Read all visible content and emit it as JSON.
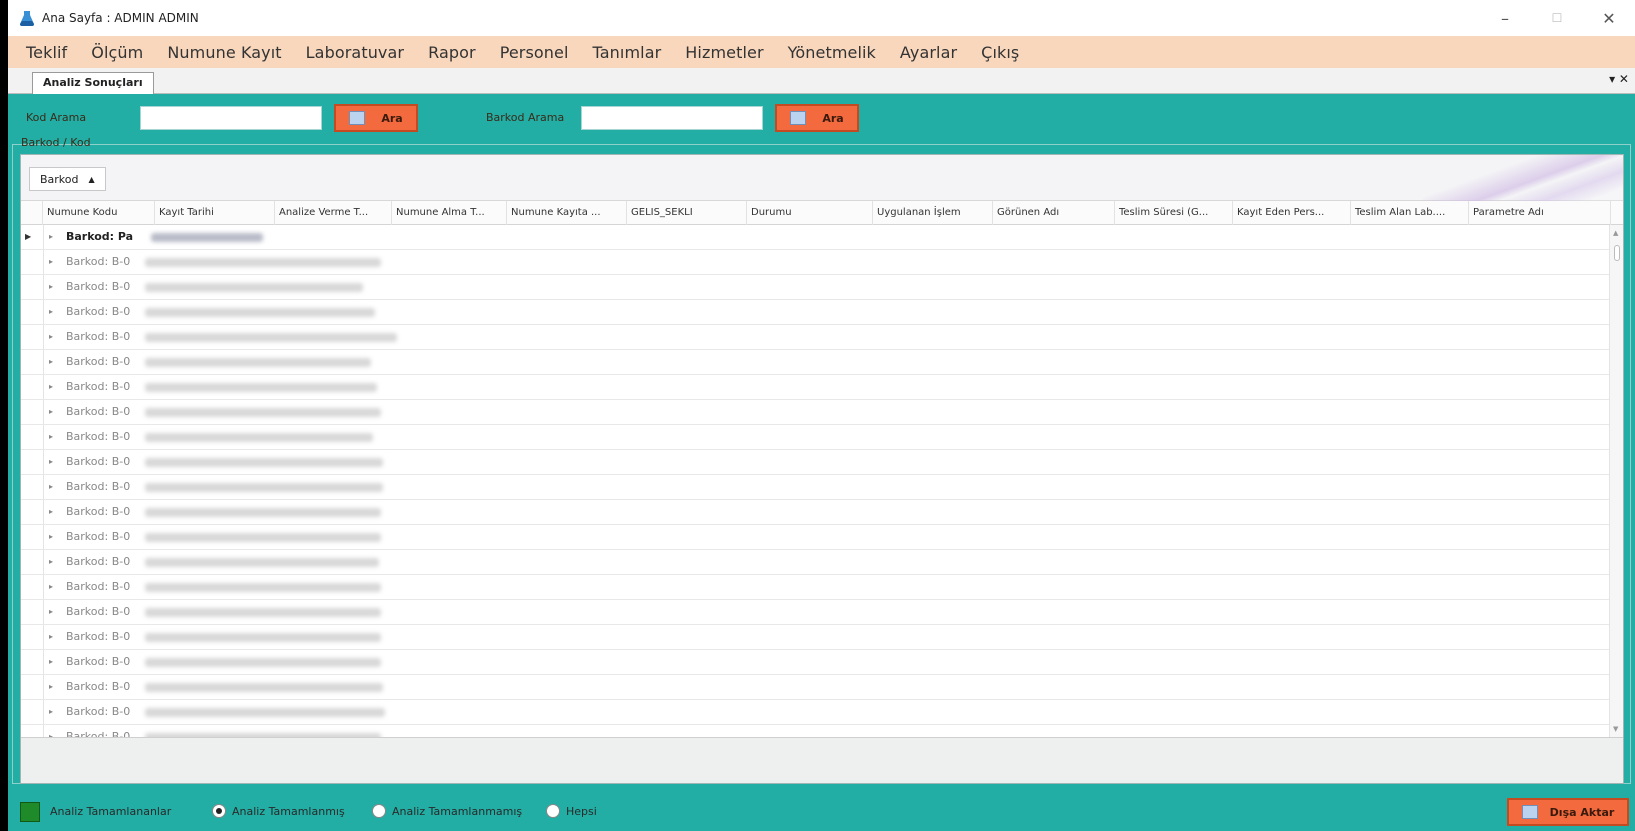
{
  "window": {
    "title": "Ana Sayfa : ADMIN ADMIN",
    "controls": {
      "minimize": "–",
      "maximize": "☐",
      "close": "✕"
    }
  },
  "menu": [
    "Teklif",
    "Ölçüm",
    "Numune Kayıt",
    "Laboratuvar",
    "Rapor",
    "Personel",
    "Tanımlar",
    "Hizmetler",
    "Yönetmelik",
    "Ayarlar",
    "Çıkış"
  ],
  "tab": {
    "label": "Analiz Sonuçları",
    "controls": "▾ ✕"
  },
  "search": {
    "kod_label": "Kod Arama",
    "kod_value": "",
    "barkod_label": "Barkod Arama",
    "barkod_value": "",
    "button_label": "Ara"
  },
  "group_box": {
    "caption": "Barkod / Kod"
  },
  "grid": {
    "group_chip": "Barkod",
    "columns": [
      "Numune Kodu",
      "Kayıt Tarihi",
      "Analize Verme T...",
      "Numune Alma T...",
      "Numune Kayıta ...",
      "GELIS_SEKLI",
      "Durumu",
      "Uygulanan İşlem",
      "Görünen Adı",
      "Teslim Süresi (G...",
      "Kayıt Eden Pers...",
      "Teslim Alan Lab....",
      "Parametre Adı"
    ],
    "rows": [
      {
        "label": "Barkod: Pa",
        "bold": true,
        "current": true
      },
      {
        "label": "Barkod: B-0",
        "bold": false
      },
      {
        "label": "Barkod: B-0",
        "bold": false
      },
      {
        "label": "Barkod: B-0",
        "bold": false
      },
      {
        "label": "Barkod: B-0",
        "bold": false
      },
      {
        "label": "Barkod: B-0",
        "bold": false
      },
      {
        "label": "Barkod: B-0",
        "bold": false
      },
      {
        "label": "Barkod: B-0",
        "bold": false
      },
      {
        "label": "Barkod: B-0",
        "bold": false
      },
      {
        "label": "Barkod: B-0",
        "bold": false
      },
      {
        "label": "Barkod: B-0",
        "bold": false
      },
      {
        "label": "Barkod: B-0",
        "bold": false
      },
      {
        "label": "Barkod: B-0",
        "bold": false
      },
      {
        "label": "Barkod: B-0",
        "bold": false
      },
      {
        "label": "Barkod: B-0",
        "bold": false
      },
      {
        "label": "Barkod: B-0",
        "bold": false
      },
      {
        "label": "Barkod: B-0",
        "bold": false
      },
      {
        "label": "Barkod: B-0",
        "bold": false
      },
      {
        "label": "Barkod: B-0",
        "bold": false
      },
      {
        "label": "Barkod: B-0",
        "bold": false
      },
      {
        "label": "Barkod: B-0",
        "bold": false
      }
    ]
  },
  "footer": {
    "legend_label": "Analiz Tamamlananlar",
    "legend_color": "#1f8a2a",
    "radios": [
      {
        "label": "Analiz Tamamlanmış",
        "checked": true
      },
      {
        "label": "Analiz Tamamlanmamış",
        "checked": false
      },
      {
        "label": "Hepsi",
        "checked": false
      }
    ],
    "export_label": "Dışa Aktar"
  },
  "colors": {
    "accent_teal": "#22aea4",
    "menu_bg": "#f8d7bd",
    "button_orange": "#f26a3d"
  }
}
